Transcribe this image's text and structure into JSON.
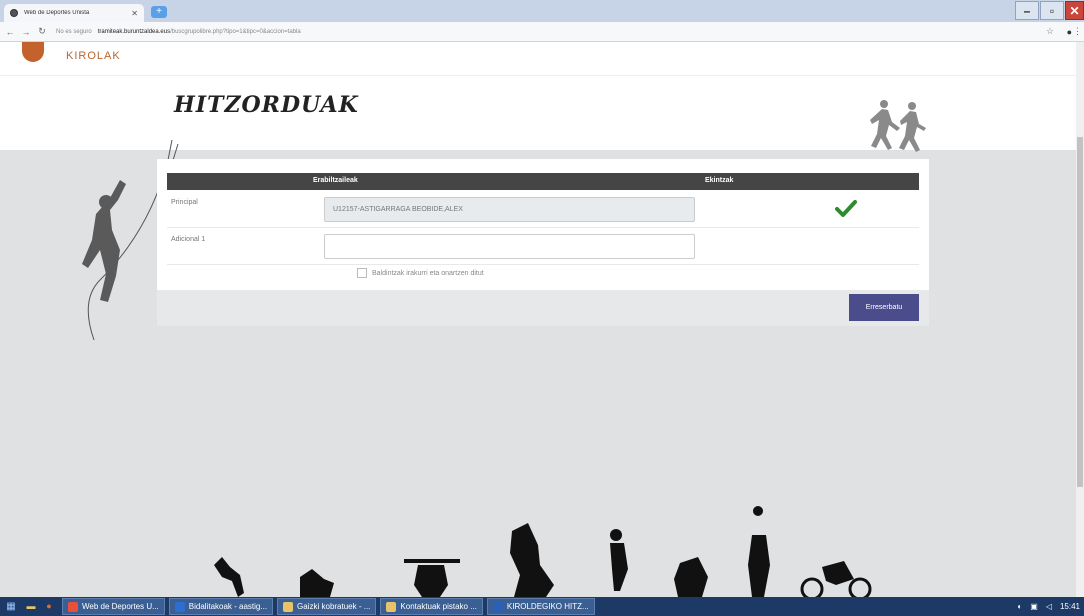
{
  "browser": {
    "tab_title": "Web de Deportes Unista",
    "url_secure": "No es seguro",
    "url_host": "tramiteak.buruntzaldea.eus",
    "url_path": "/buscgrupolibre.php?tipo=1&tipc=0&accion=tabla"
  },
  "site": {
    "logo_text": "KIROLAK",
    "page_title": "HITZORDUAK"
  },
  "table": {
    "headers": [
      "Erabiltzaileak",
      "Ekintzak"
    ],
    "rows": [
      {
        "label": "Principal",
        "value": "U12157-ASTIGARRAGA BEOBIDE,ALEX",
        "status": "check"
      },
      {
        "label": "Adicional 1",
        "value": ""
      }
    ]
  },
  "form": {
    "agree_label": "Baldintzak irakurri eta onartzen ditut",
    "submit_label": "Erreserbatu"
  },
  "taskbar": {
    "tasks": [
      "Web de Deportes U...",
      "Bidalitakoak - aastig...",
      "Gaizki kobratuek - ...",
      "Kontaktuak pistako ...",
      "KIROLDEGIKO HITZ..."
    ],
    "clock": "15:41"
  },
  "colors": {
    "header_bg": "#454545",
    "submit_bg": "#4a4c8c",
    "check": "#2e8b2e",
    "brand": "#b9652f"
  }
}
